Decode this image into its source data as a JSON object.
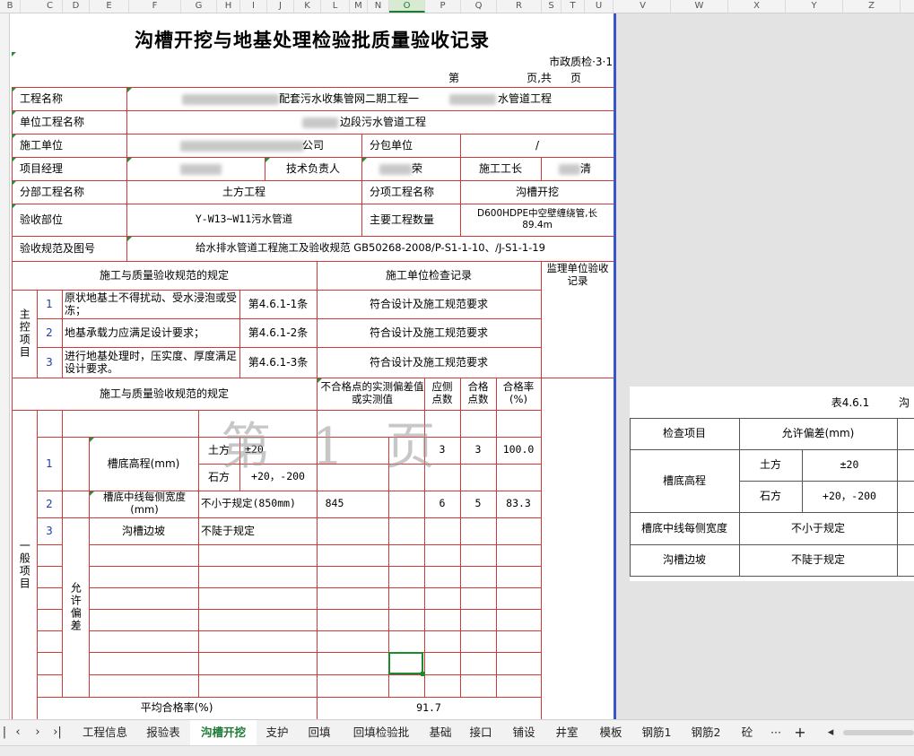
{
  "columns": [
    "B",
    "C",
    "D",
    "E",
    "F",
    "G",
    "H",
    "I",
    "J",
    "K",
    "L",
    "M",
    "N",
    "O",
    "P",
    "Q",
    "R",
    "S",
    "T",
    "U",
    "V",
    "W",
    "X",
    "Y",
    "Z"
  ],
  "form": {
    "title": "沟槽开挖与地基处理检验批质量验收记录",
    "code": "市政质检·3·1",
    "page_di": "第",
    "page_ye_gong": "页,共",
    "page_ye": "页",
    "project_name_label": "工程名称",
    "project_name_value": "配套污水收集管网二期工程一",
    "project_name_suffix": "水管道工程",
    "unit_project_label": "单位工程名称",
    "unit_project_value": "边段污水管道工程",
    "construction_unit_label": "施工单位",
    "construction_unit_value": "公司",
    "subcontract_label": "分包单位",
    "subcontract_value": "/",
    "pm_label": "项目经理",
    "tech_lead_label": "技术负责人",
    "tech_lead_value": "荣",
    "foreman_label": "施工工长",
    "foreman_value": "清",
    "division_label": "分部工程名称",
    "division_value": "土方工程",
    "subitem_label": "分项工程名称",
    "subitem_value": "沟槽开挖",
    "location_label": "验收部位",
    "location_value": "Y-W13~W11污水管道",
    "quantity_label": "主要工程数量",
    "quantity_value": "D600HDPE中空壁缠绕管,长89.4m",
    "spec_label": "验收规范及图号",
    "spec_value": "给水排水管道工程施工及验收规范 GB50268-2008/P-S1-1-10、/J-S1-1-19",
    "spec_header": "施工与质量验收规范的规定",
    "check_record_header": "施工单位检查记录",
    "supervisor_header": "监理单位验收记录",
    "main_items_label": "主控项目",
    "main_items": [
      {
        "no": "1",
        "text": "原状地基土不得扰动、受水浸泡或受冻；",
        "clause": "第4.6.1-1条",
        "result": "符合设计及施工规范要求"
      },
      {
        "no": "2",
        "text": "地基承载力应满足设计要求；",
        "clause": "第4.6.1-2条",
        "result": "符合设计及施工规范要求"
      },
      {
        "no": "3",
        "text": "进行地基处理时，压实度、厚度满足设计要求。",
        "clause": "第4.6.1-3条",
        "result": "符合设计及施工规范要求"
      }
    ],
    "unqualified_header": "不合格点的实测偏差值或实测值",
    "points_header": "应侧点数",
    "pass_points_header": "合格点数",
    "pass_rate_header": "合格率(%)",
    "general_items_label": "一般项目",
    "tolerance_label": "允许偏差",
    "general_rows": [
      {
        "no": "1",
        "name": "槽底高程(mm)",
        "sub": "土方",
        "tolerance": "±20",
        "measured": "",
        "points": "3",
        "passed": "3",
        "rate": "100.0"
      },
      {
        "no": "",
        "name": "",
        "sub": "石方",
        "tolerance": "+20，-200",
        "measured": "",
        "points": "",
        "passed": "",
        "rate": ""
      },
      {
        "no": "2",
        "name": "槽底中线每侧宽度(mm)",
        "sub": "",
        "tolerance": "不小于规定(850mm)",
        "measured": "845",
        "points": "6",
        "passed": "5",
        "rate": "83.3"
      },
      {
        "no": "3",
        "name": "沟槽边坡",
        "sub": "",
        "tolerance": "不陡于规定",
        "measured": "",
        "points": "",
        "passed": "",
        "rate": ""
      }
    ],
    "avg_rate_label": "平均合格率(%)",
    "avg_rate_value": "91.7",
    "watermark": "第 1 页"
  },
  "side_table": {
    "title": "表4.6.1",
    "title_suffix": "沟",
    "header_item": "检查项目",
    "header_tolerance": "允许偏差(mm)",
    "row1_item": "槽底高程",
    "row1_sub1": "土方",
    "row1_val1": "±20",
    "row1_sub2": "石方",
    "row1_val2": "+20，-200",
    "row2_item": "槽底中线每侧宽度",
    "row2_val": "不小于规定",
    "row3_item": "沟槽边坡",
    "row3_val": "不陡于规定"
  },
  "tabs": [
    "工程信息",
    "报验表",
    "沟槽开挖",
    "支护",
    "回填",
    "回填检验批",
    "基础",
    "接口",
    "铺设",
    "井室",
    "模板",
    "钢筋1",
    "钢筋2",
    "砼"
  ],
  "active_tab": "沟槽开挖",
  "tab_more": "···",
  "tab_add": "+",
  "colors": {
    "grid_red": "#d23a3a",
    "active_green": "#1e7b34",
    "page_break_blue": "#3a55c9"
  }
}
